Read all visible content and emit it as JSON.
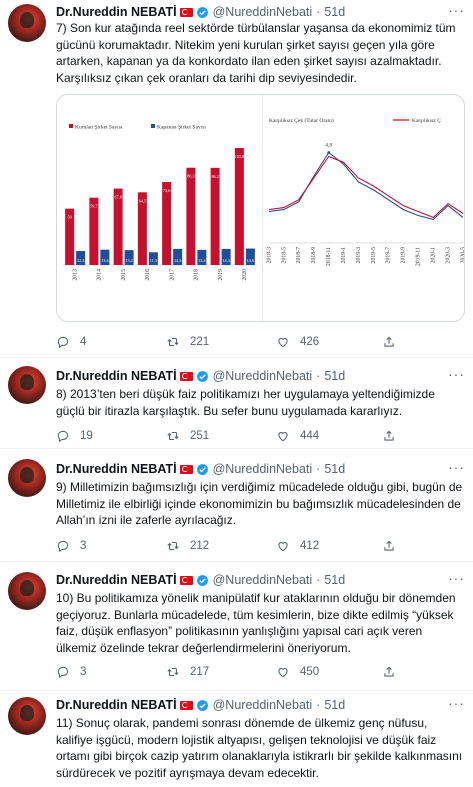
{
  "author": {
    "name": "Dr.Nureddin NEBATİ",
    "handle": "@NureddinNebati"
  },
  "tweets": [
    {
      "time": "51d",
      "text": "7) Son kur atağında reel sektörde türbülanslar yaşansa da ekonomimiz tüm gücünü korumaktadır. Nitekim yeni kurulan şirket sayısı geçen yıla göre artarken, kapanan ya da konkordato ilan eden şirket sayısı azalmaktadır. Karşılıksız çıkan çek oranları da tarihi dip seviyesindedir.",
      "replies": "4",
      "retweets": "221",
      "likes": "426"
    },
    {
      "time": "51d",
      "text": "8) 2013’ten beri düşük faiz politikamızı her uygulamaya yeltendiğimizde güçlü bir itirazla karşılaştık. Bu sefer bunu uygulamada kararlıyız.",
      "replies": "19",
      "retweets": "251",
      "likes": "444"
    },
    {
      "time": "51d",
      "text": "9) Milletimizin bağımsızlığı için verdiğimiz mücadelede olduğu gibi, bugün de Milletimiz ile elbirliği içinde ekonomimizin bu bağımsızlık mücadelesinden de Allah’ın izni ile zaferle ayrılacağız.",
      "replies": "3",
      "retweets": "212",
      "likes": "412"
    },
    {
      "time": "51d",
      "text": "10) Bu politikamıza yönelik manipülatif kur ataklarının olduğu bir dönemden geçiyoruz. Bunlarla mücadelede, tüm kesimlerin, bize dikte edilmiş “yüksek faiz, düşük enflasyon” politikasının yanlışlığını yapısal cari açık veren ülkemiz özelinde tekrar değerlendirmelerini öneriyorum.",
      "replies": "3",
      "retweets": "217",
      "likes": "450"
    },
    {
      "time": "51d",
      "text": "11) Sonuç olarak, pandemi sonrası dönemde de ülkemiz genç nüfusu, kalifiye işgücü, modern lojistik altyapısı,  gelişen teknolojisi ve düşük faiz ortamı gibi birçok cazip yatırım olanaklarıyla istikrarlı bir şekilde kalkınmasını sürdürecek ve pozitif ayrışmaya devam edecektir.",
      "replies": "",
      "retweets": "",
      "likes": ""
    }
  ],
  "chart_data": [
    {
      "type": "bar",
      "categories": [
        "2013",
        "2014",
        "2015",
        "2016",
        "2017",
        "2018",
        "2019",
        "2020"
      ],
      "series": [
        {
          "name": "Kurulan Şirket Sayısı",
          "color": "#c8102e",
          "values": [
            50,
            59.7,
            67.8,
            64.5,
            73.6,
            86.3,
            86.2,
            103.8
          ]
        },
        {
          "name": "Kapanan Şirket Sayısı",
          "color": "#1f4e9c",
          "values": [
            12.4,
            13.6,
            13.2,
            11.3,
            14.3,
            13.4,
            14.3,
            14.6
          ]
        }
      ],
      "data_labels": [
        "50",
        "12,4",
        "59,7",
        "13,6",
        "67,8",
        "13,2",
        "64,5",
        "11,3",
        "73,6",
        "14,3",
        "86,3",
        "13,4",
        "86,2",
        "14,3",
        "103,8",
        "14,6"
      ],
      "title": "",
      "xlabel": "",
      "ylabel": "",
      "ylim": [
        0,
        110
      ],
      "legend": "top"
    },
    {
      "type": "line",
      "x": [
        "2018-3",
        "2018-5",
        "2018-7",
        "2018-9",
        "2018-11",
        "2019-1",
        "2019-3",
        "2019-5",
        "2019-7",
        "2019-9",
        "2019-11",
        "2020-1",
        "2020-3",
        "2020-5"
      ],
      "series": [
        {
          "name": "Karşılıksız Çek (Tutar Oranı)",
          "color": "#1f4e9c",
          "values": [
            1.6,
            1.7,
            2.1,
            3.4,
            4.6,
            4.0,
            3.1,
            2.7,
            2.2,
            1.7,
            1.4,
            1.2,
            1.9,
            1.3
          ]
        },
        {
          "name": "Karşılıksız Ç",
          "color": "#c8102e",
          "values": [
            1.7,
            1.8,
            2.2,
            3.3,
            4.4,
            4.1,
            3.3,
            2.9,
            2.4,
            1.9,
            1.6,
            1.3,
            2.0,
            1.5
          ]
        }
      ],
      "peak_label": "4,8",
      "title": "",
      "xlabel": "",
      "ylabel": "",
      "ylim": [
        0,
        6
      ],
      "legend": "top"
    }
  ]
}
